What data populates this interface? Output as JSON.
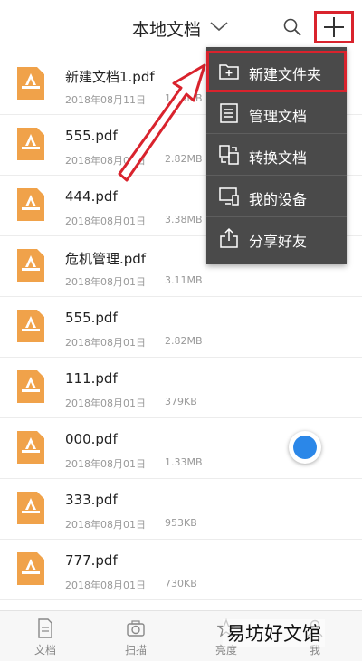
{
  "header": {
    "title": "本地文档",
    "icons": [
      "chevron-down-icon",
      "search-icon",
      "plus-icon"
    ]
  },
  "files": [
    {
      "name": "新建文档1.pdf",
      "date": "2018年08月11日",
      "size": "1.08MB"
    },
    {
      "name": "555.pdf",
      "date": "2018年08月08日",
      "size": "2.82MB"
    },
    {
      "name": "444.pdf",
      "date": "2018年08月01日",
      "size": "3.38MB"
    },
    {
      "name": "危机管理.pdf",
      "date": "2018年08月01日",
      "size": "3.11MB"
    },
    {
      "name": "555.pdf",
      "date": "2018年08月01日",
      "size": "2.82MB"
    },
    {
      "name": "111.pdf",
      "date": "2018年08月01日",
      "size": "379KB"
    },
    {
      "name": "000.pdf",
      "date": "2018年08月01日",
      "size": "1.33MB"
    },
    {
      "name": "333.pdf",
      "date": "2018年08月01日",
      "size": "953KB"
    },
    {
      "name": "777.pdf",
      "date": "2018年08月01日",
      "size": "730KB"
    }
  ],
  "menu": [
    {
      "label": "新建文件夹",
      "icon": "new-folder-icon"
    },
    {
      "label": "管理文档",
      "icon": "list-icon"
    },
    {
      "label": "转换文档",
      "icon": "convert-icon"
    },
    {
      "label": "我的设备",
      "icon": "device-icon"
    },
    {
      "label": "分享好友",
      "icon": "share-icon"
    }
  ],
  "tabs": [
    {
      "label": "文档",
      "icon": "document-icon"
    },
    {
      "label": "扫描",
      "icon": "camera-icon"
    },
    {
      "label": "亮度",
      "icon": "star-icon"
    },
    {
      "label": "我",
      "icon": "user-icon"
    }
  ],
  "watermark": "易坊好文馆",
  "colors": {
    "highlight": "#d9232d",
    "menu_bg": "#4a4a4a",
    "pdf_orange": "#f0a24a",
    "fab_blue": "#2b87e8"
  }
}
